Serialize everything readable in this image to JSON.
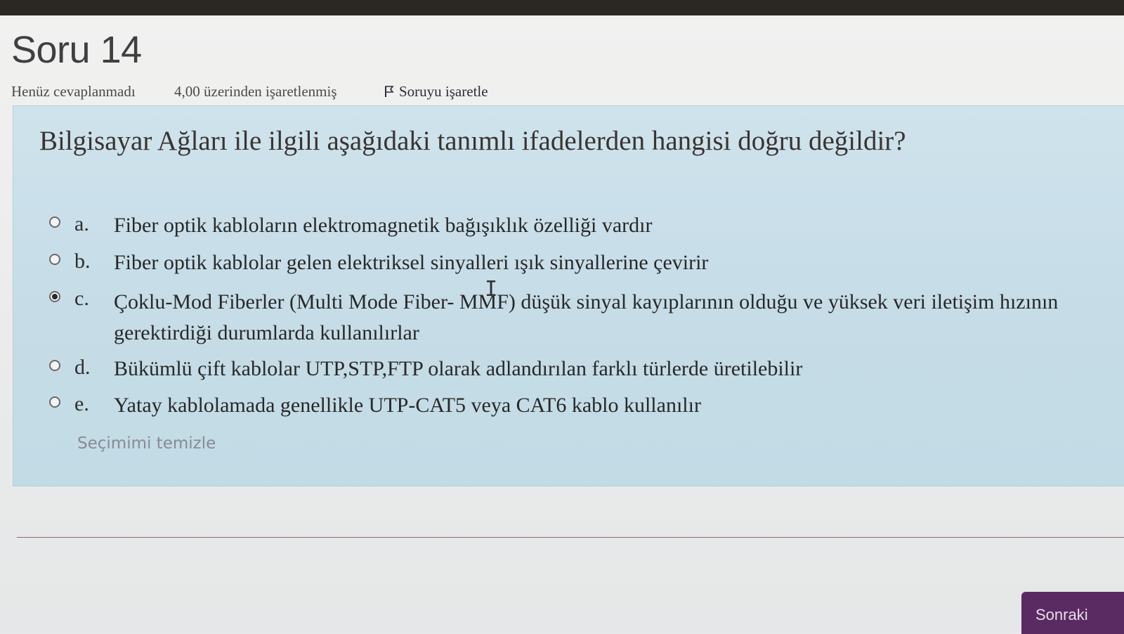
{
  "question_header": {
    "title": "Soru 14",
    "status": "Henüz cevaplanmadı",
    "points": "4,00 üzerinden işaretlenmiş",
    "flag_label": "Soruyu işaretle"
  },
  "question": {
    "text": "Bilgisayar Ağları ile ilgili aşağıdaki tanımlı ifadelerden hangisi doğru değildir?",
    "answers": [
      {
        "letter": "a.",
        "text": "Fiber optik kabloların elektromagnetik bağışıklık özelliği vardır",
        "selected": false
      },
      {
        "letter": "b.",
        "text": "Fiber optik kablolar gelen elektriksel sinyalleri ışık sinyallerine çevirir",
        "selected": false
      },
      {
        "letter": "c.",
        "text": "Çoklu-Mod Fiberler (Multi Mode Fiber- MMF) düşük sinyal kayıplarının olduğu ve yüksek veri iletişim hızının gerektirdiği durumlarda kullanılırlar",
        "selected": true
      },
      {
        "letter": "d.",
        "text": "Bükümlü çift kablolar UTP,STP,FTP olarak adlandırılan farklı türlerde üretilebilir",
        "selected": false
      },
      {
        "letter": "e.",
        "text": "Yatay kablolamada genellikle UTP-CAT5 veya CAT6 kablo kullanılır",
        "selected": false
      }
    ],
    "clear_label": "Seçimimi temizle"
  },
  "navigation": {
    "next_label": "Sonraki"
  },
  "icons": {
    "flag": "flag-icon",
    "cursor": "text-cursor-icon"
  },
  "colors": {
    "question_bg": "#c7dde8",
    "next_button": "#5a2a62",
    "title": "#3f3f3f"
  }
}
